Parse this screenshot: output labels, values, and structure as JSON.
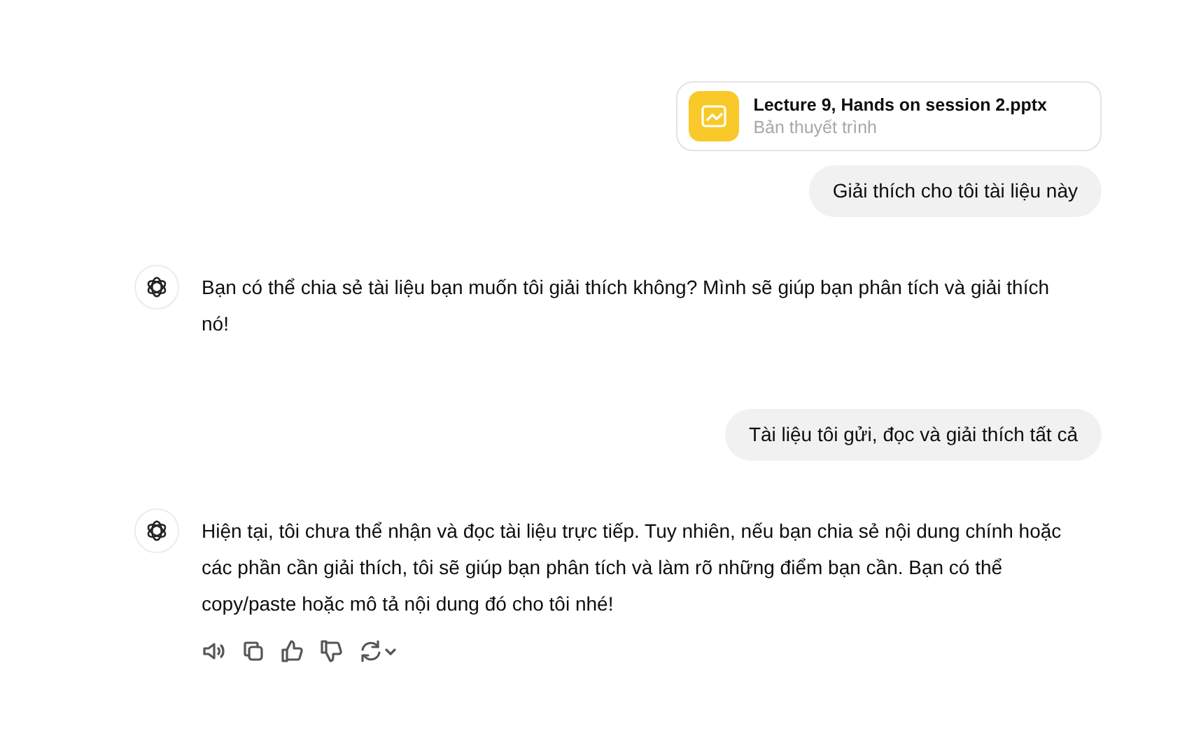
{
  "messages": [
    {
      "kind": "attachment",
      "name": "Lecture 9, Hands on session 2.pptx",
      "type": "Bản thuyết trình"
    },
    {
      "kind": "user",
      "text": "Giải thích cho tôi tài liệu này"
    },
    {
      "kind": "assistant",
      "text": "Bạn có thể chia sẻ tài liệu bạn muốn tôi giải thích không? Mình sẽ giúp bạn phân tích và giải thích nó!",
      "actions": false
    },
    {
      "kind": "user",
      "text": "Tài liệu tôi gửi, đọc và giải thích tất cả"
    },
    {
      "kind": "assistant",
      "text": "Hiện tại, tôi chưa thể nhận và đọc tài liệu trực tiếp. Tuy nhiên, nếu bạn chia sẻ nội dung chính hoặc các phần cần giải thích, tôi sẽ giúp bạn phân tích và làm rõ những điểm bạn cần. Bạn có thể copy/paste hoặc mô tả nội dung đó cho tôi nhé!",
      "actions": true
    }
  ]
}
